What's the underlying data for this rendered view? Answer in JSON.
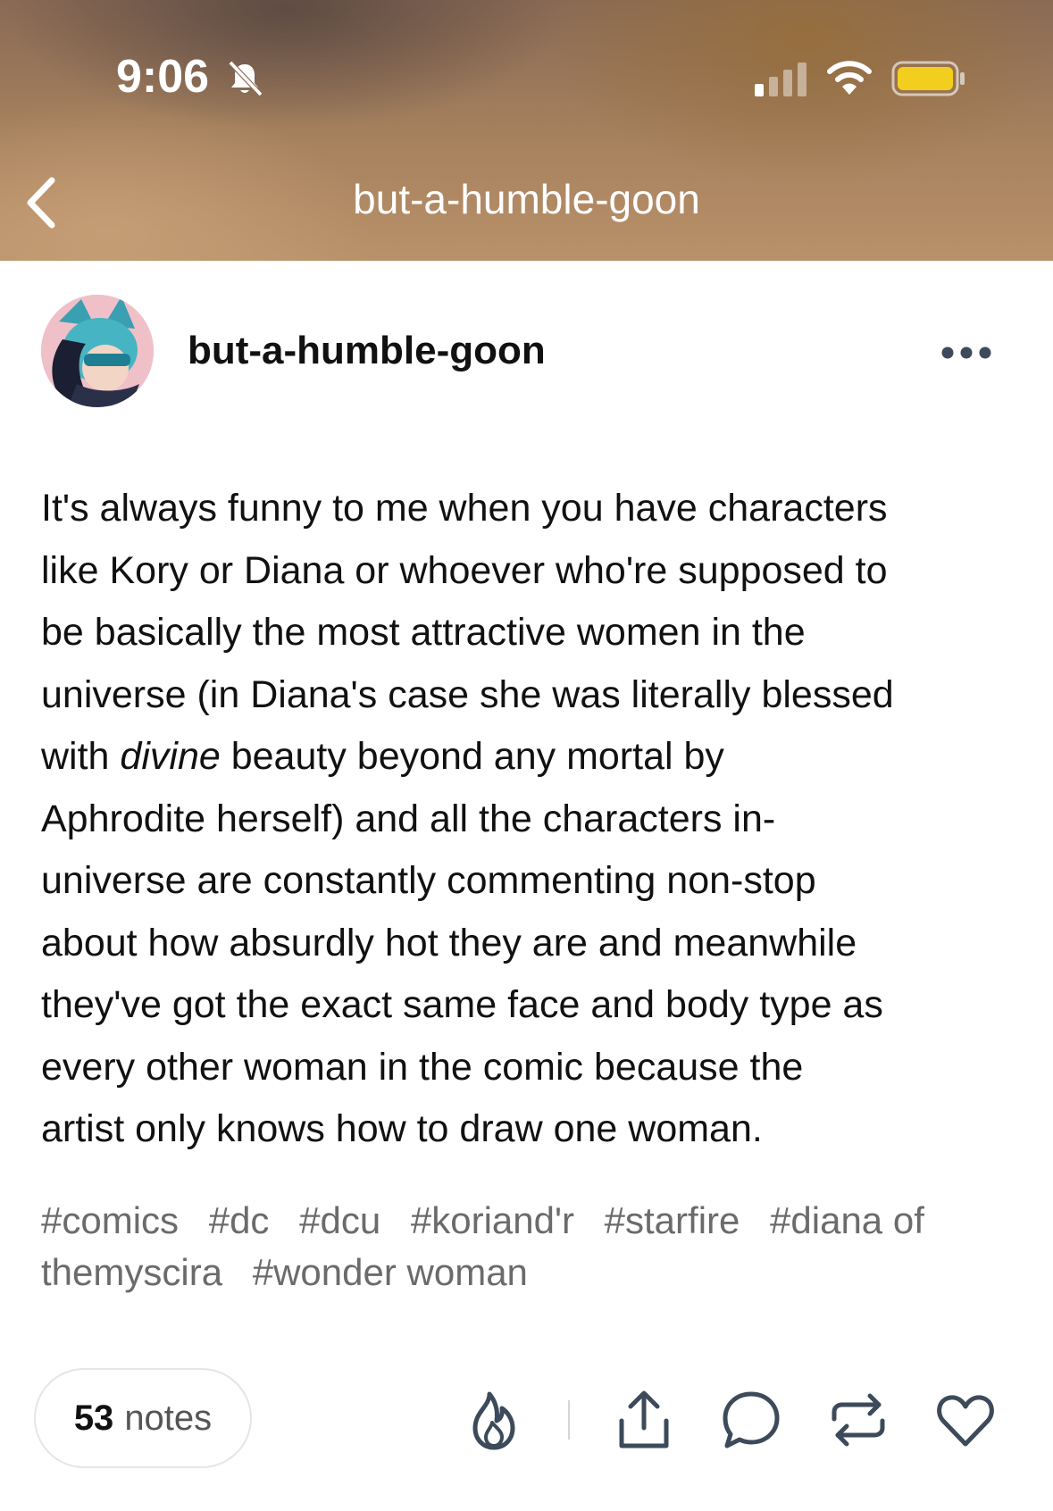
{
  "status_bar": {
    "time": "9:06",
    "icons": [
      "bell-slash-icon",
      "signal-icon",
      "wifi-icon",
      "battery-icon"
    ],
    "battery_color": "#f2cf1f"
  },
  "nav": {
    "title": "but-a-humble-goon",
    "back_icon": "chevron-left-icon"
  },
  "post": {
    "blog_name": "but-a-humble-goon",
    "more_icon": "more-dots-icon",
    "body_before": "It's always funny to me when you have characters\nlike Kory or Diana or whoever who're supposed to\nbe basically the most attractive women in the\nuniverse (in Diana's case she was literally blessed\nwith ",
    "body_emphasis": "divine",
    "body_after": " beauty beyond any mortal by\nAphrodite herself) and all the characters in-\nuniverse are constantly commenting non-stop\nabout how absurdly hot they are and meanwhile\nthey've got the exact same face and body type as\nevery other woman in the comic because the\nartist only knows how to draw one woman.",
    "tags": [
      "#comics",
      "#dc",
      "#dcu",
      "#koriand'r",
      "#starfire",
      "#diana of themyscira",
      "#wonder woman"
    ]
  },
  "footer": {
    "notes_count": "53",
    "notes_label": "notes",
    "actions": [
      "flame-icon",
      "share-icon",
      "comment-icon",
      "reblog-icon",
      "heart-icon"
    ],
    "icon_color": "#3c4a5a"
  }
}
